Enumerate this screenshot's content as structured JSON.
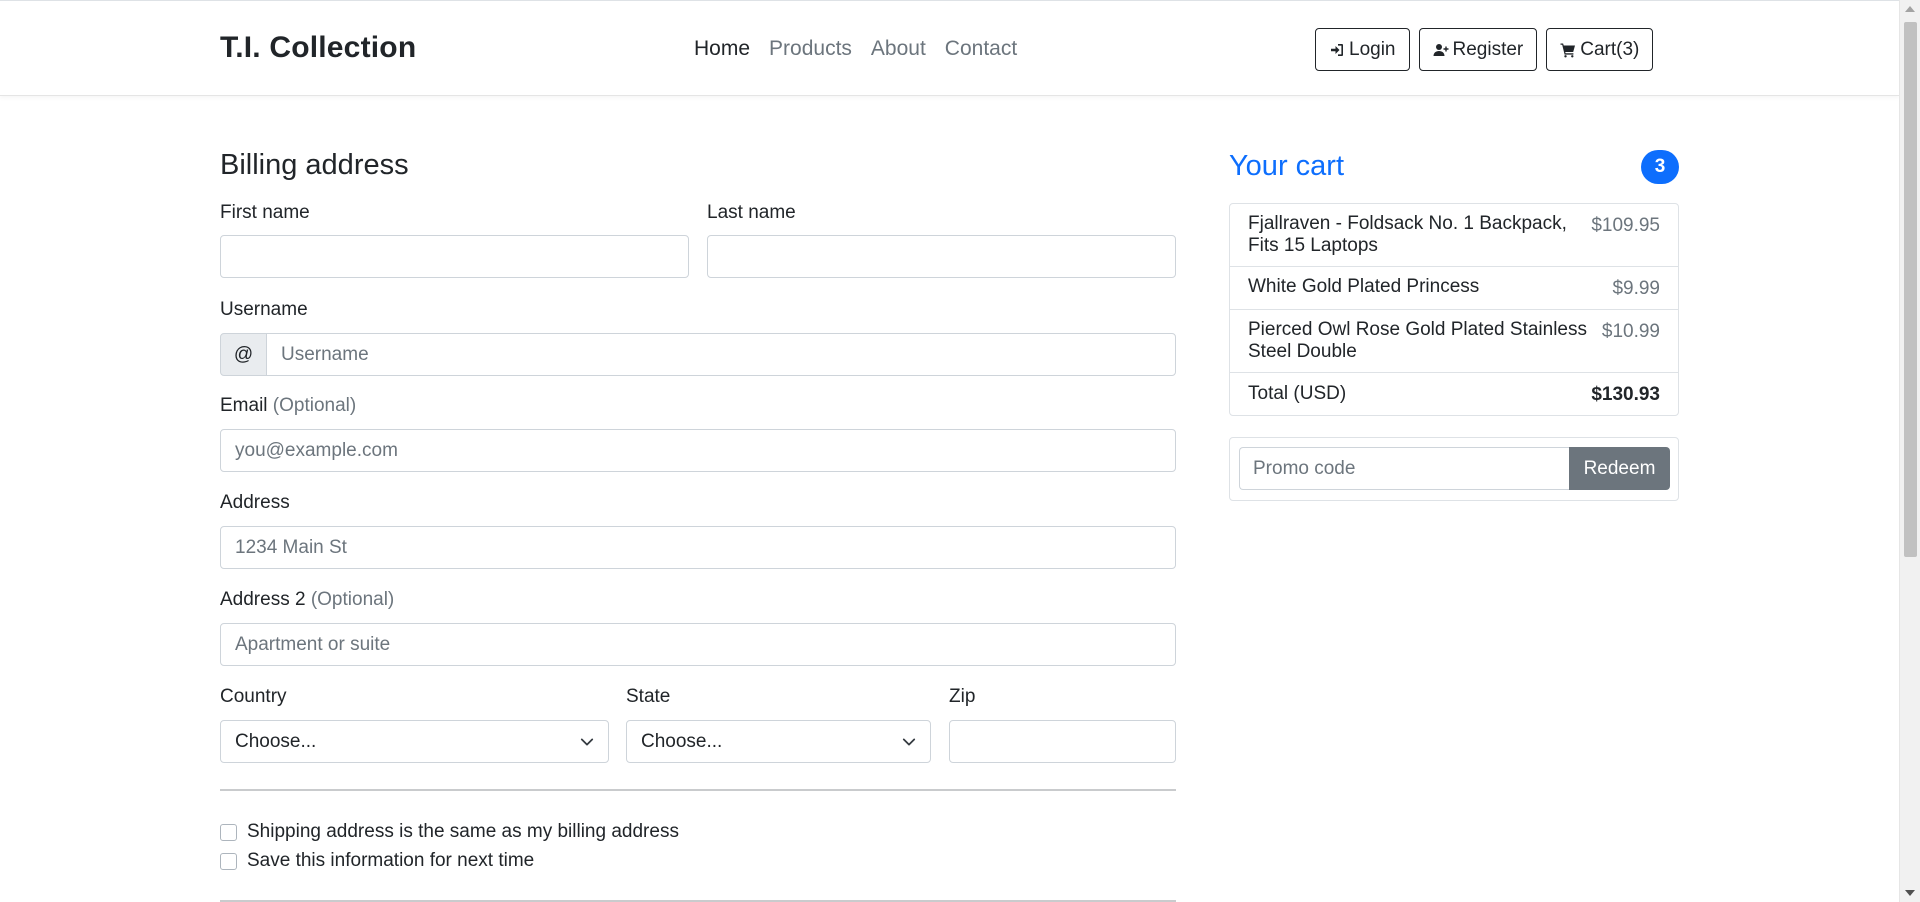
{
  "navbar": {
    "brand": "T.I. Collection",
    "links": [
      "Home",
      "Products",
      "About",
      "Contact"
    ],
    "active_link": "Home",
    "login_label": "Login",
    "register_label": "Register",
    "cart_label": "Cart(3)"
  },
  "billing": {
    "heading": "Billing address",
    "first_name_label": "First name",
    "last_name_label": "Last name",
    "username_label": "Username",
    "username_prefix": "@",
    "username_placeholder": "Username",
    "email_label": "Email",
    "email_optional": "(Optional)",
    "email_placeholder": "you@example.com",
    "address_label": "Address",
    "address_placeholder": "1234 Main St",
    "address2_label": "Address 2",
    "address2_optional": "(Optional)",
    "address2_placeholder": "Apartment or suite",
    "country_label": "Country",
    "country_value": "Choose...",
    "state_label": "State",
    "state_value": "Choose...",
    "zip_label": "Zip",
    "same_address_label": "Shipping address is the same as my billing address",
    "save_info_label": "Save this information for next time"
  },
  "cart": {
    "title": "Your cart",
    "count": "3",
    "items": [
      {
        "name": "Fjallraven - Foldsack No. 1 Backpack, Fits 15 Laptops",
        "price": "$109.95"
      },
      {
        "name": "White Gold Plated Princess",
        "price": "$9.99"
      },
      {
        "name": "Pierced Owl Rose Gold Plated Stainless Steel Double",
        "price": "$10.99"
      }
    ],
    "total_label": "Total (USD)",
    "total_value": "$130.93",
    "promo_placeholder": "Promo code",
    "redeem_label": "Redeem"
  },
  "colors": {
    "primary": "#0d6efd",
    "secondary": "#6c757d",
    "text": "#212529",
    "border": "#ced4da"
  }
}
